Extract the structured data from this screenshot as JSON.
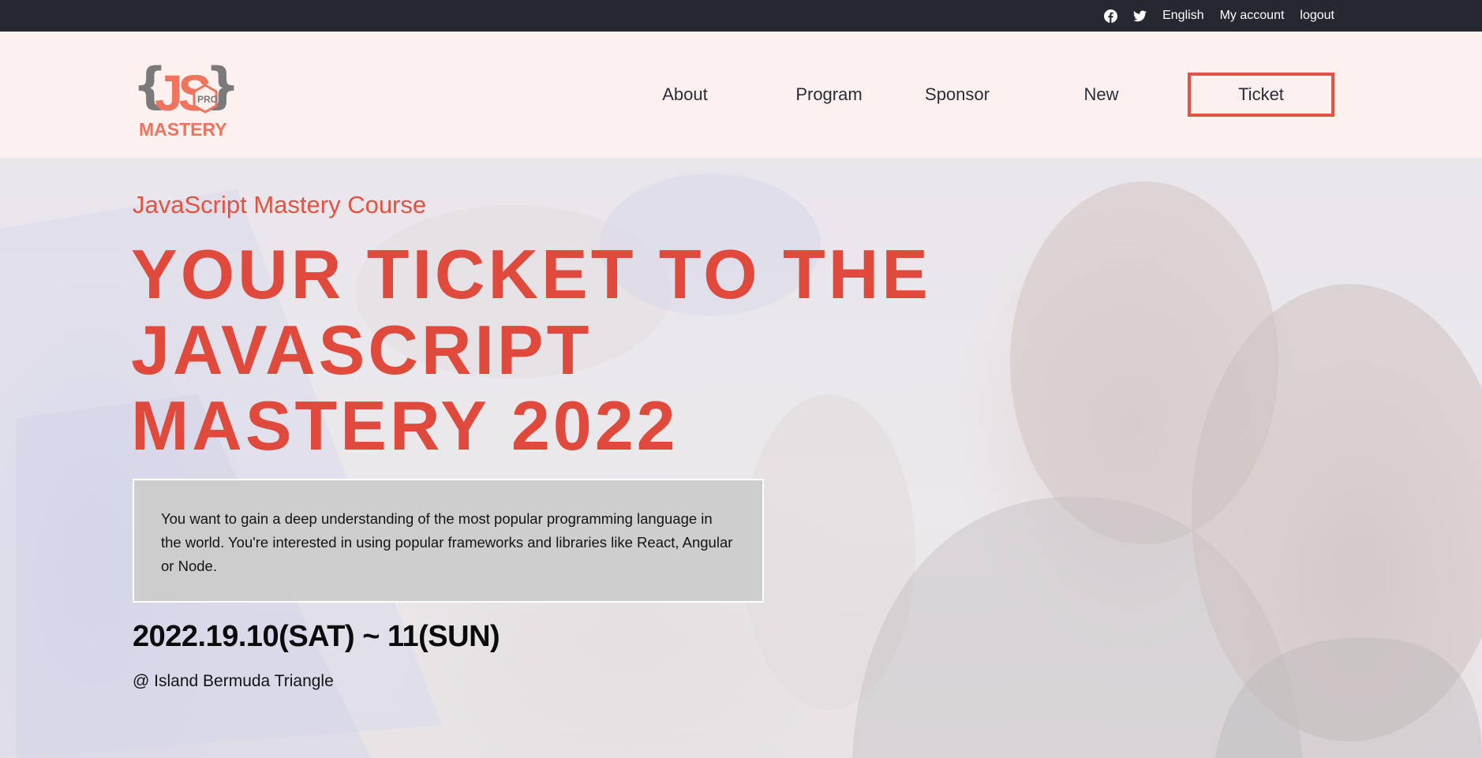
{
  "topbar": {
    "icons": [
      "facebook-icon",
      "twitter-icon"
    ],
    "language": "English",
    "account": "My account",
    "logout": "logout"
  },
  "logo": {
    "brace_left": "{",
    "brace_right": "}",
    "letters": "JS",
    "badge": "PRO",
    "word": "MASTERY"
  },
  "nav": {
    "items": [
      "About",
      "Program",
      "Sponsor",
      "New",
      "Ticket"
    ]
  },
  "hero": {
    "course": "JavaScript Mastery Course",
    "headline_line1": "YOUR TICKET TO THE",
    "headline_line2": "JAVASCRIPT",
    "headline_line3": "MASTERY 2022",
    "description": "You want to gain a deep understanding of the most popular programming language in the world. You're interested in using popular frameworks and libraries like React, Angular or Node.",
    "date": "2022.19.10(SAT) ~ 11(SUN)",
    "venue": "@ Island Bermuda Triangle"
  },
  "colors": {
    "accent": "#e35342",
    "topbar": "#252830",
    "header": "#fdf1f0"
  }
}
